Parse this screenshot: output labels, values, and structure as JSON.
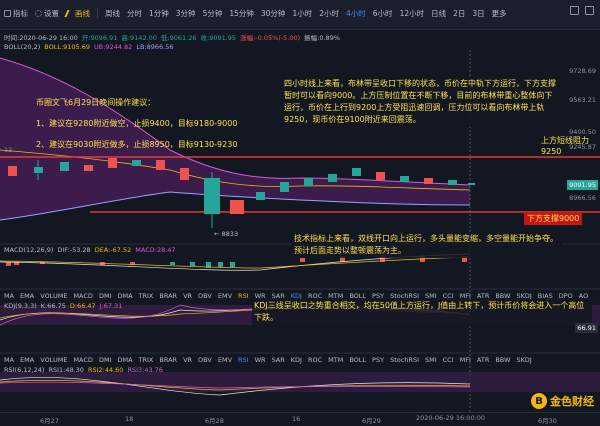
{
  "toolbar": {
    "items": [
      "指标",
      "设置",
      "画线",
      "周线",
      "分时",
      "1分钟",
      "3分钟",
      "5分钟",
      "15分钟",
      "30分钟",
      "1小时",
      "2小时",
      "4小时",
      "6小时",
      "12小时",
      "日线",
      "2日",
      "3日"
    ],
    "active_tool": "画线",
    "active_timeframe": "4小时",
    "more_label": "更多"
  },
  "ohlc": {
    "time": "时间:2020-06-29 16:00",
    "open": "开:9096.91",
    "high": "高:9142.00",
    "low": "低:9061.26",
    "close": "收:9091.95",
    "change": "涨幅:-0.05%(-5.00)",
    "amplitude": "振幅:0.89%"
  },
  "boll": {
    "name": "BOLL(20,2)",
    "mid": "BOLL:9105.69",
    "ub": "UB:9244.82",
    "lb": "LB:8966.56"
  },
  "price_axis": {
    "ticks": [
      "9728.69",
      "9563.21",
      "9400.50",
      "9245.87",
      "8966.56"
    ],
    "current_tag": "9091.95",
    "left_marker": "12",
    "low_marker": "8833"
  },
  "annotations": {
    "advice_title": "币圈文飞6月29日晚间操作建议：",
    "advice_1": "1、建议在9280附近做空，止损9400，目标9180-9000",
    "advice_2": "2、建议在9030附近做多，止损8950，目标9130-9230",
    "analysis_4h": "四小时线上来看，布林带呈收口下移的状态，币价在中轨下方运行，下方支撑暂时可以看向9000。上方压制位置在不断下移，目前的布林带重心整体向下运行，币价在上行到9200上方受阻迅速回调，压力位可以看向布林带上轨9250，现币价在9100附近来回震荡。",
    "resistance_label": "上方短线阻力9250",
    "support_label": "下方支撑9000",
    "macd_note": "技术指标上来看，双线开口向上运行，多头量能变缩，多空量能开始争夺。预计后面走势以整顿震荡为主。",
    "kdj_note": "KDJ三线呈收口之势重合相交，均在50值上方运行，J值由上转下，预计币价将会进入一个高位下跌。"
  },
  "macd": {
    "name": "MACD(12,26,9)",
    "dif": "DIF:-53.28",
    "dea": "DEA:-67.52",
    "macd": "MACD:28.47"
  },
  "indicator_tabs": [
    "MA",
    "EMA",
    "VOLUME",
    "MACD",
    "DMI",
    "DMA",
    "TRIX",
    "BRAR",
    "VR",
    "OBV",
    "EMV",
    "RSI",
    "WR",
    "SAR",
    "KDJ",
    "ROC",
    "MTM",
    "BOLL",
    "PSY",
    "StochRSI",
    "SMI",
    "CCI",
    "MFI",
    "ATR",
    "BBW",
    "SKDJ",
    "BIAS",
    "DPO",
    "AO"
  ],
  "indicator_tabs_2": [
    "MA",
    "EMA",
    "VOLUME",
    "MACD",
    "DMI",
    "DMA",
    "TRIX",
    "BRAR",
    "VR",
    "OBV",
    "EMV",
    "RSI",
    "WR",
    "SAR",
    "KDJ",
    "ROC",
    "MTM",
    "BOLL",
    "PSY",
    "StochRSI",
    "SMI",
    "CCI",
    "MFI",
    "ATR",
    "BBW",
    "SKDJ"
  ],
  "kdj": {
    "name": "KDJ(9,3,3)",
    "k": "K:66.75",
    "d": "D:66.47",
    "j": "J:67.31",
    "axis_value": "66.91"
  },
  "rsi": {
    "name": "RSI(6,12,24)",
    "rsi1": "RSI1:48.30",
    "rsi2": "RSI2:44.60",
    "rsi3": "RSI3:43.76"
  },
  "xaxis": {
    "labels": [
      "6月27",
      "18",
      "6月28",
      "16",
      "6月29",
      "18",
      "6月30"
    ],
    "cursor_time": "2020-06-29 16:00:00"
  },
  "watermark": {
    "logo_char": "B",
    "text": "金色财经"
  },
  "colors": {
    "up": "#26a69a",
    "down": "#ef5350",
    "boll_band": "#6b2a78",
    "resistance": "#e53935",
    "annotation": "#ffe24a"
  }
}
